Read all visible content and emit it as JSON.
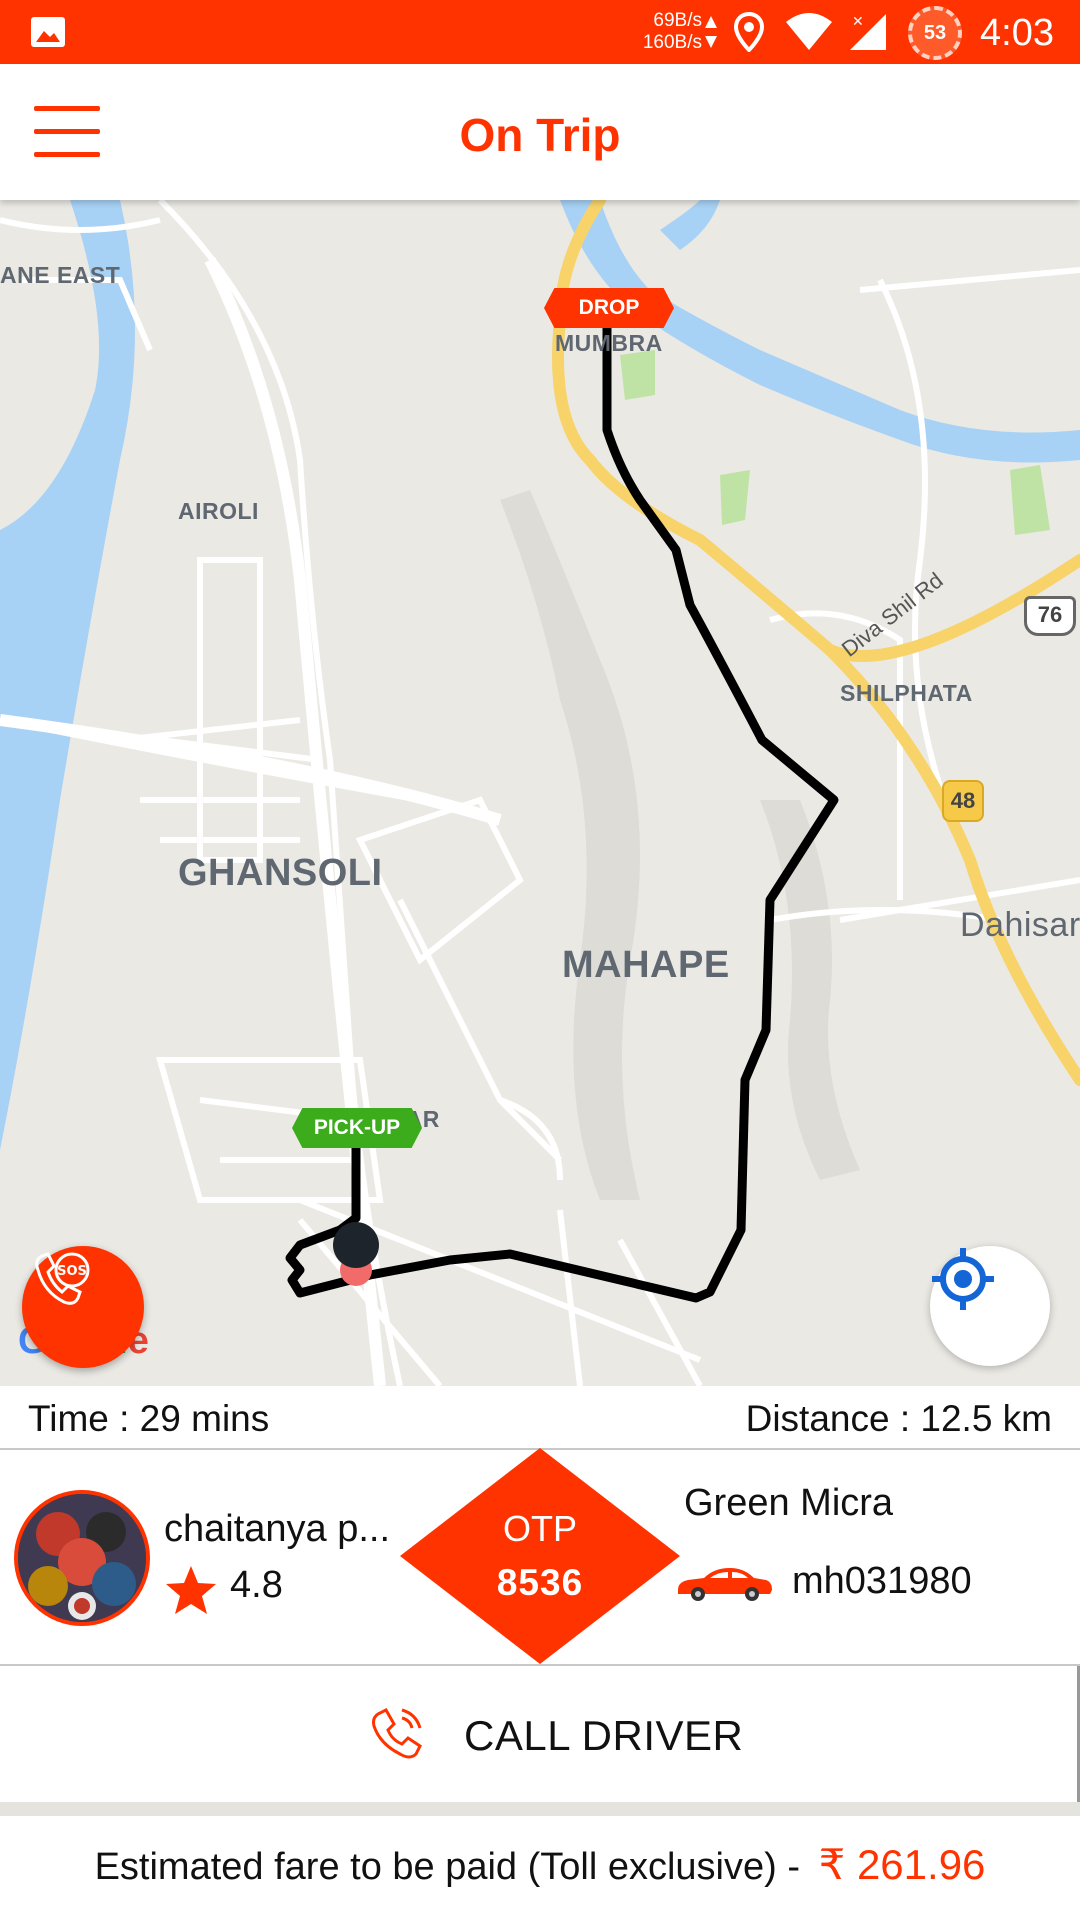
{
  "status_bar": {
    "net_down": "69B/s",
    "net_up": "160B/s",
    "battery": "53",
    "time": "4:03",
    "icons": [
      "image-icon",
      "location-icon",
      "wifi-icon",
      "signal-icon"
    ]
  },
  "app_bar": {
    "title": "On Trip",
    "menu_icon": "hamburger-menu-icon"
  },
  "map": {
    "labels": {
      "thane_east": "ANE EAST",
      "mumbra": "MUMBRA",
      "airoli": "AIROLI",
      "shilphata": "SHILPHATA",
      "ghansoli": "GHANSOLI",
      "mahape": "MAHAPE",
      "dahisar": "Dahisar",
      "kopar": "KOPAR",
      "diva_shil_rd": "Diva Shil Rd",
      "highway_76": "76",
      "highway_48": "48"
    },
    "drop_marker": "DROP",
    "pickup_marker": "PICK-UP",
    "google_logo": "Google",
    "sos_label": "SOS",
    "colors": {
      "water": "#a8d2f5",
      "road": "#ffffff",
      "highway": "#f7d36a",
      "route": "#000000",
      "park": "#bfe3a4"
    }
  },
  "trip": {
    "time": "Time : 29 mins",
    "distance": "Distance : 12.5 km"
  },
  "driver": {
    "name": "chaitanya p...",
    "rating": "4.8",
    "otp_label": "OTP",
    "otp_code": "8536",
    "car_model": "Green Micra",
    "car_number": "mh031980"
  },
  "actions": {
    "call_driver": "CALL DRIVER"
  },
  "fare": {
    "label": "Estimated fare to be paid (Toll exclusive) -",
    "amount": "₹ 261.96"
  },
  "theme": {
    "accent": "#ff3300",
    "pickup": "#3cab1c"
  }
}
